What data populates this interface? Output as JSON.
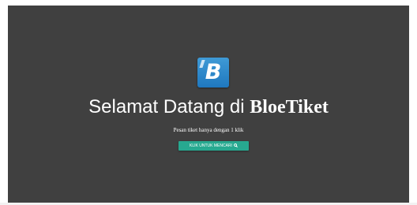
{
  "hero": {
    "logo_letter": "B",
    "title_prefix": "Selamat Datang di ",
    "brand_name": "BloeTiket",
    "subtitle": "Pesan tiket hanya dengan 1 klik",
    "cta_label": "KLIK UNTUK MENCARI",
    "cta_icon": "search-icon"
  },
  "colors": {
    "background": "#404040",
    "logo": "#2a86cb",
    "cta": "#27a990",
    "text": "#ffffff"
  }
}
